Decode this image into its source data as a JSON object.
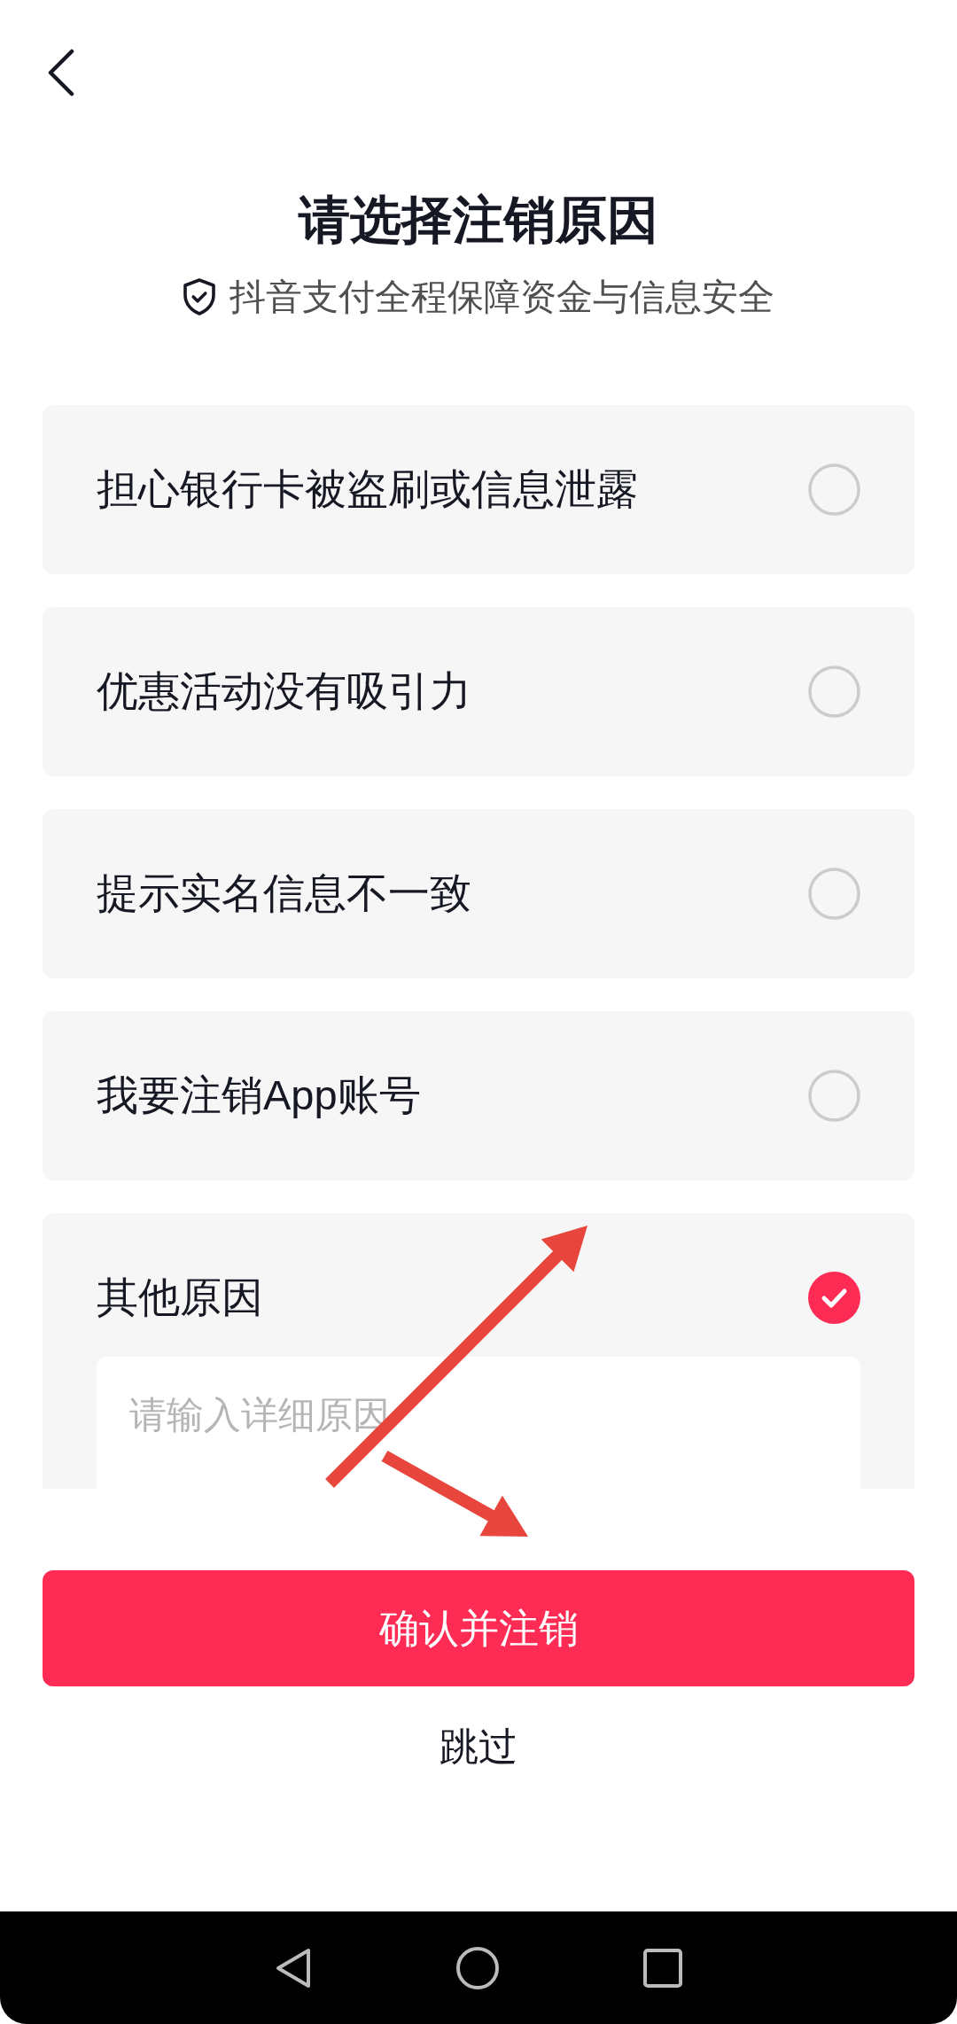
{
  "header": {
    "title": "请选择注销原因",
    "subtitle": "抖音支付全程保障资金与信息安全"
  },
  "reasons": [
    {
      "label": "担心银行卡被盗刷或信息泄露",
      "selected": false
    },
    {
      "label": "优惠活动没有吸引力",
      "selected": false
    },
    {
      "label": "提示实名信息不一致",
      "selected": false
    },
    {
      "label": "我要注销App账号",
      "selected": false
    },
    {
      "label": "其他原因",
      "selected": true,
      "detail_field": {
        "placeholder": "请输入详细原因"
      }
    }
  ],
  "confirm_button": {
    "label": "确认并注销"
  },
  "skip_link": {
    "label": "跳过"
  }
}
